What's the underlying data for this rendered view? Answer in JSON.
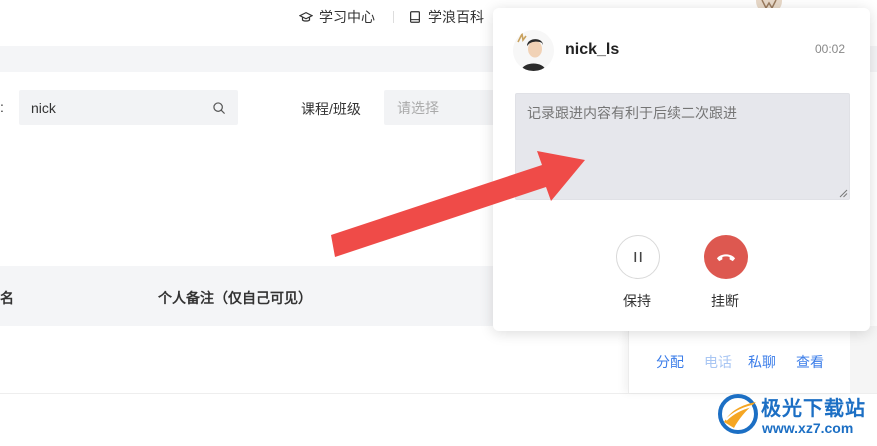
{
  "nav": {
    "items": [
      {
        "label": "学习中心",
        "icon": "graduation-cap-icon"
      },
      {
        "label": "学浪百科",
        "icon": "book-icon"
      }
    ]
  },
  "filters": {
    "name_value": "nick",
    "course_label": "课程/班级",
    "course_placeholder": "请选择"
  },
  "table": {
    "columns": [
      "名",
      "个人备注（仅自己可见）"
    ]
  },
  "row_actions": [
    "分配",
    "电话",
    "私聊",
    "查看"
  ],
  "call": {
    "name": "nick_ls",
    "timer": "00:02",
    "notes_placeholder": "记录跟进内容有利于后续二次跟进",
    "hold_label": "保持",
    "hangup_label": "挂断"
  },
  "watermark": {
    "title": "极光下载站",
    "url": "www.xz7.com"
  },
  "colors": {
    "accent": "#3b7de9",
    "hangup": "#dd5850",
    "arrow": "#ef4b48"
  }
}
